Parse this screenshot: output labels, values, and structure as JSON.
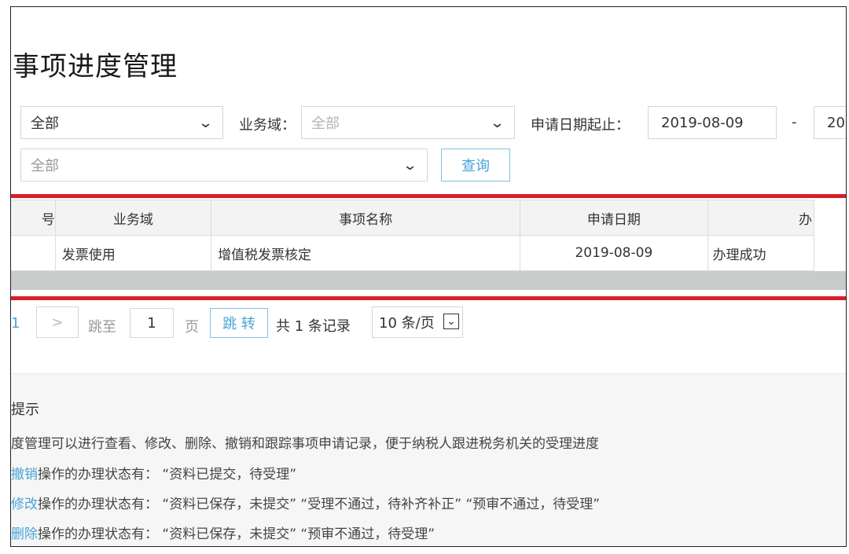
{
  "page": {
    "title": "事项进度管理"
  },
  "filters": {
    "status_select": {
      "value": "全部"
    },
    "domain_label": "业务域：",
    "domain_select": {
      "value": "全部"
    },
    "date_label": "申请日期起止：",
    "date_from": "2019-08-09",
    "date_sep": "-",
    "date_to_partial": "20",
    "item_select": {
      "value": "全部"
    },
    "query_button": "查询"
  },
  "table": {
    "headers": [
      "号",
      "业务域",
      "事项名称",
      "申请日期",
      "办"
    ],
    "rows": [
      {
        "domain": "发票使用",
        "name": "增值税发票核定",
        "date": "2019-08-09",
        "status": "办理成功"
      }
    ]
  },
  "pager": {
    "current_page": "1",
    "next": ">",
    "jump_label": "跳至",
    "jump_value": "1",
    "page_unit": "页",
    "jump_button": "跳 转",
    "total": "共 1 条记录",
    "page_size": "10 条/页"
  },
  "tips": {
    "title": "提示",
    "line1": "度管理可以进行查看、修改、删除、撤销和跟踪事项申请记录，便于纳税人跟进税务机关的受理进度",
    "line2_action": "撤销",
    "line2_text": "操作的办理状态有：  “资料已提交，待受理”",
    "line3_action": "修改",
    "line3_text": "操作的办理状态有：  “资料已保存，未提交”    “受理不通过，待补齐补正”    “预审不通过，待受理”",
    "line4_action": "删除",
    "line4_text": "操作的办理状态有：  “资料已保存，未提交”    “预审不通过，待受理”"
  },
  "colors": {
    "accent": "#4aa3d8",
    "highlight_red": "#d91e2a",
    "grey_bar": "#c9cbca"
  }
}
